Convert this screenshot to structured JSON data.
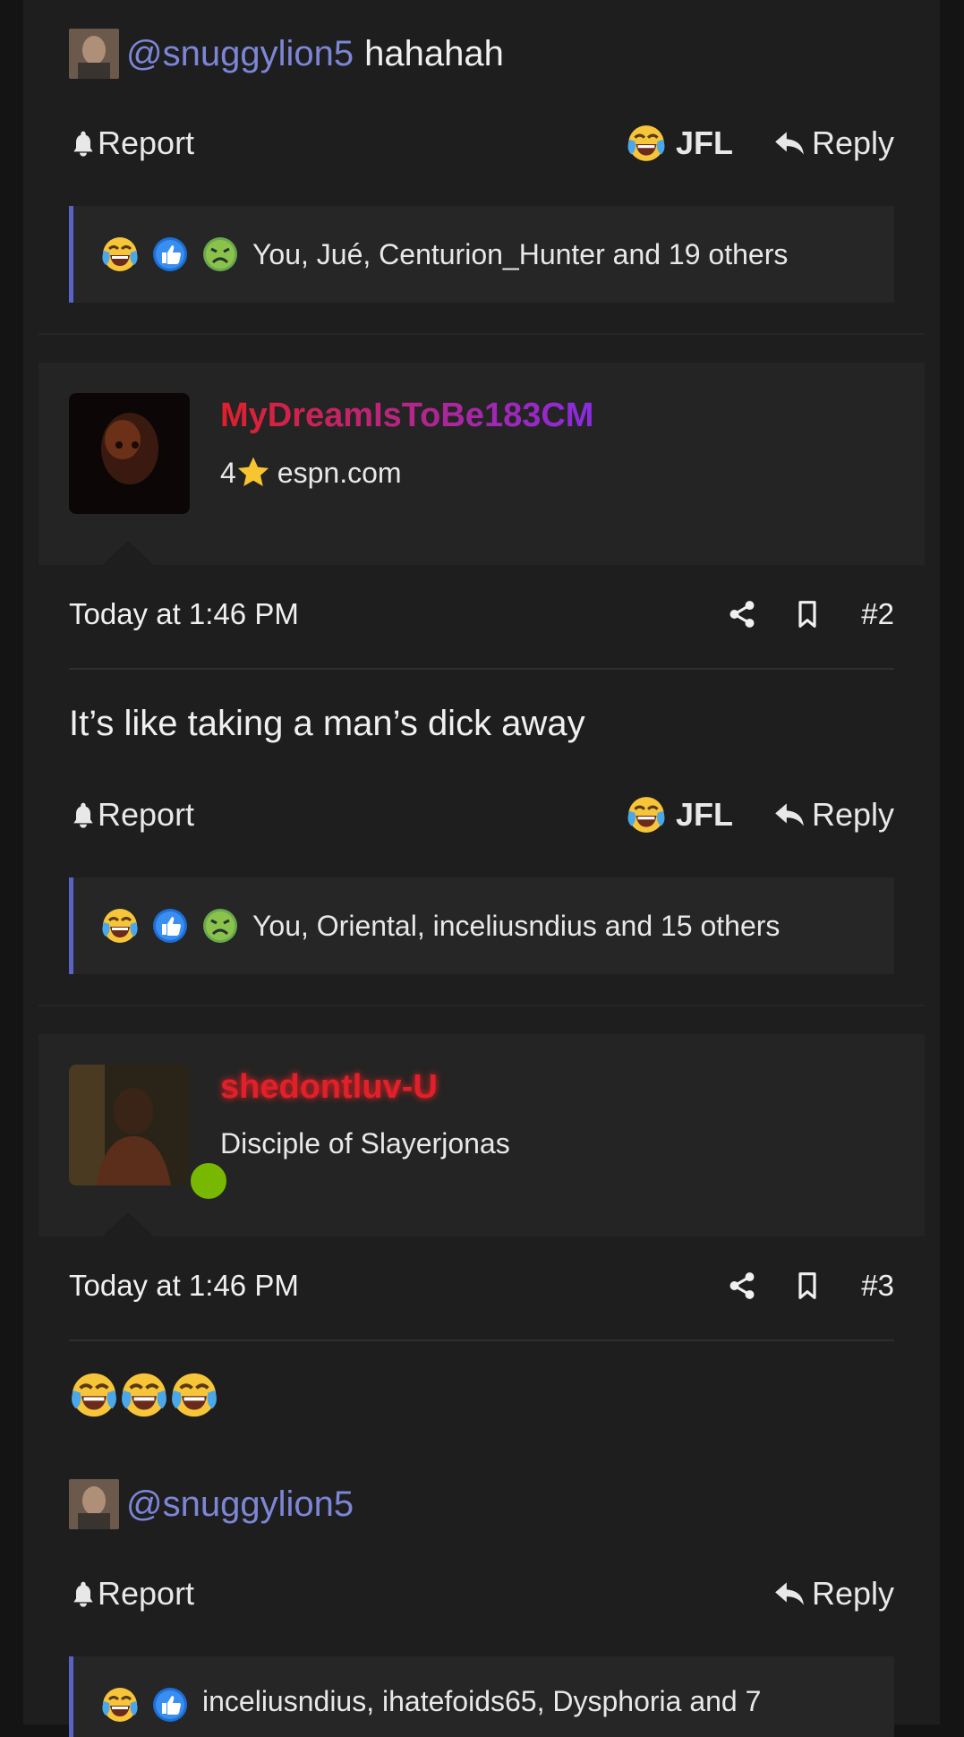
{
  "post1": {
    "mention": {
      "handle": "@snuggylion5",
      "tail": "hahahah"
    },
    "actions": {
      "report": "Report",
      "reaction": "JFL",
      "reply": "Reply"
    },
    "reactions": {
      "text": "You, Jué, Centurion_Hunter and 19 others"
    }
  },
  "post2": {
    "user": {
      "name": "MyDreamIsToBe183CM",
      "title_prefix": "4",
      "title_suffix": "espn.com"
    },
    "meta": {
      "time": "Today at 1:46 PM",
      "number": "#2"
    },
    "body": "It’s like taking a man’s dick away",
    "actions": {
      "report": "Report",
      "reaction": "JFL",
      "reply": "Reply"
    },
    "reactions": {
      "text": "You, Oriental, inceliusndius and 15 others"
    }
  },
  "post3": {
    "user": {
      "name": "shedontluv-U",
      "title": "Disciple of Slayerjonas"
    },
    "meta": {
      "time": "Today at 1:46 PM",
      "number": "#3"
    },
    "mention": {
      "handle": "@snuggylion5"
    },
    "actions": {
      "report": "Report",
      "reply": "Reply"
    },
    "reactions": {
      "text": "inceliusndius, ihatefoids65, Dysphoria and 7"
    }
  },
  "colors": {
    "accent": "#5a62c8",
    "mention": "#7d86d6",
    "online": "#78b800",
    "name_red": "#e0202a",
    "name_purple": "#8a2be2"
  }
}
